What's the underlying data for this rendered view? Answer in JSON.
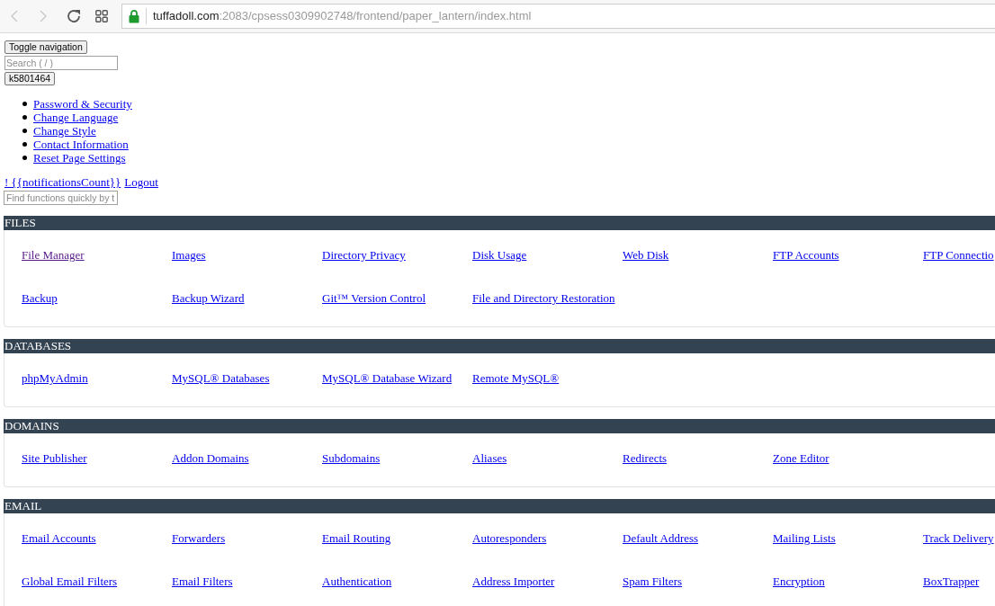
{
  "browser": {
    "nav": [
      {
        "kind": "back",
        "disabled": true
      },
      {
        "kind": "forward",
        "disabled": true
      },
      {
        "kind": "reload",
        "disabled": false
      },
      {
        "kind": "apps",
        "disabled": false
      }
    ],
    "address": {
      "host": "tuffadoll.com",
      "path": ":2083/cpsess0309902748/frontend/paper_lantern/index.html"
    }
  },
  "header": {
    "toggle_button": "Toggle navigation",
    "search": {
      "placeholder": "Search ( / )"
    },
    "user_button": "k5801464",
    "user_menu": [
      "Password & Security",
      "Change Language",
      "Change Style",
      "Contact Information",
      "Reset Page Settings"
    ],
    "notifications_link": "! {{notificationsCount}}",
    "logout_link": "Logout",
    "quick_find": {
      "placeholder": "Find functions quickly by t"
    }
  },
  "sections": [
    {
      "title": "FILES",
      "items": [
        {
          "label": "File Manager",
          "visited": true
        },
        {
          "label": "Images",
          "visited": false
        },
        {
          "label": "Directory Privacy",
          "visited": false
        },
        {
          "label": "Disk Usage",
          "visited": false
        },
        {
          "label": "Web Disk",
          "visited": false
        },
        {
          "label": "FTP Accounts",
          "visited": false
        },
        {
          "label": "FTP Connectio",
          "visited": false
        },
        {
          "label": "Backup",
          "visited": false
        },
        {
          "label": "Backup Wizard",
          "visited": false
        },
        {
          "label": "Git™ Version Control",
          "visited": false
        },
        {
          "label": "File and Directory Restoration",
          "visited": false
        }
      ]
    },
    {
      "title": "DATABASES",
      "items": [
        {
          "label": "phpMyAdmin",
          "visited": false
        },
        {
          "label": "MySQL® Databases",
          "visited": false
        },
        {
          "label": "MySQL® Database Wizard",
          "visited": false
        },
        {
          "label": "Remote MySQL®",
          "visited": false
        }
      ]
    },
    {
      "title": "DOMAINS",
      "items": [
        {
          "label": "Site Publisher",
          "visited": false
        },
        {
          "label": "Addon Domains",
          "visited": false
        },
        {
          "label": "Subdomains",
          "visited": false
        },
        {
          "label": "Aliases",
          "visited": false
        },
        {
          "label": "Redirects",
          "visited": false
        },
        {
          "label": "Zone Editor",
          "visited": false
        }
      ]
    },
    {
      "title": "EMAIL",
      "items": [
        {
          "label": "Email Accounts",
          "visited": false
        },
        {
          "label": "Forwarders",
          "visited": false
        },
        {
          "label": "Email Routing",
          "visited": false
        },
        {
          "label": "Autoresponders",
          "visited": false
        },
        {
          "label": "Default Address",
          "visited": false
        },
        {
          "label": "Mailing Lists",
          "visited": false
        },
        {
          "label": "Track Delivery",
          "visited": false
        },
        {
          "label": "Global Email Filters",
          "visited": false
        },
        {
          "label": "Email Filters",
          "visited": false
        },
        {
          "label": "Authentication",
          "visited": false
        },
        {
          "label": "Address Importer",
          "visited": false
        },
        {
          "label": "Spam Filters",
          "visited": false
        },
        {
          "label": "Encryption",
          "visited": false
        },
        {
          "label": "BoxTrapper",
          "visited": false
        }
      ]
    }
  ]
}
